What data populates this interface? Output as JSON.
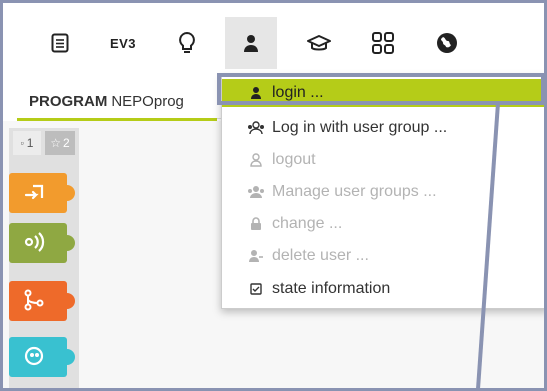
{
  "topbar": {
    "icons": [
      "document-icon",
      "ev3-icon",
      "lightbulb-icon",
      "user-icon",
      "graduation-cap-icon",
      "grid-icon",
      "globe-icon"
    ],
    "ev3_label": "EV3"
  },
  "tabs": {
    "program_label": "PROGRAM",
    "program_name": "NEPOprog"
  },
  "toolbox": {
    "level1": "1",
    "level2": "2",
    "categories": [
      {
        "name": "action",
        "color": "#f29b2d"
      },
      {
        "name": "sensors",
        "color": "#8fa842"
      },
      {
        "name": "control",
        "color": "#ee6a2a"
      },
      {
        "name": "robot",
        "color": "#39c1d0"
      }
    ]
  },
  "user_menu": {
    "items": [
      {
        "label": "login ...",
        "icon": "user-icon",
        "state": "highlight"
      },
      {
        "label": "Log in with user group ...",
        "icon": "user-group-icon",
        "state": "enabled"
      },
      {
        "label": "logout",
        "icon": "user-outline-icon",
        "state": "disabled"
      },
      {
        "label": "Manage user groups ...",
        "icon": "users-icon",
        "state": "disabled"
      },
      {
        "label": "change ...",
        "icon": "lock-icon",
        "state": "disabled"
      },
      {
        "label": "delete user ...",
        "icon": "user-minus-icon",
        "state": "disabled"
      },
      {
        "label": "state information",
        "icon": "checkbox-icon",
        "state": "enabled"
      }
    ]
  },
  "colors": {
    "highlight": "#b5cc18",
    "callout": "#8a93b2"
  }
}
